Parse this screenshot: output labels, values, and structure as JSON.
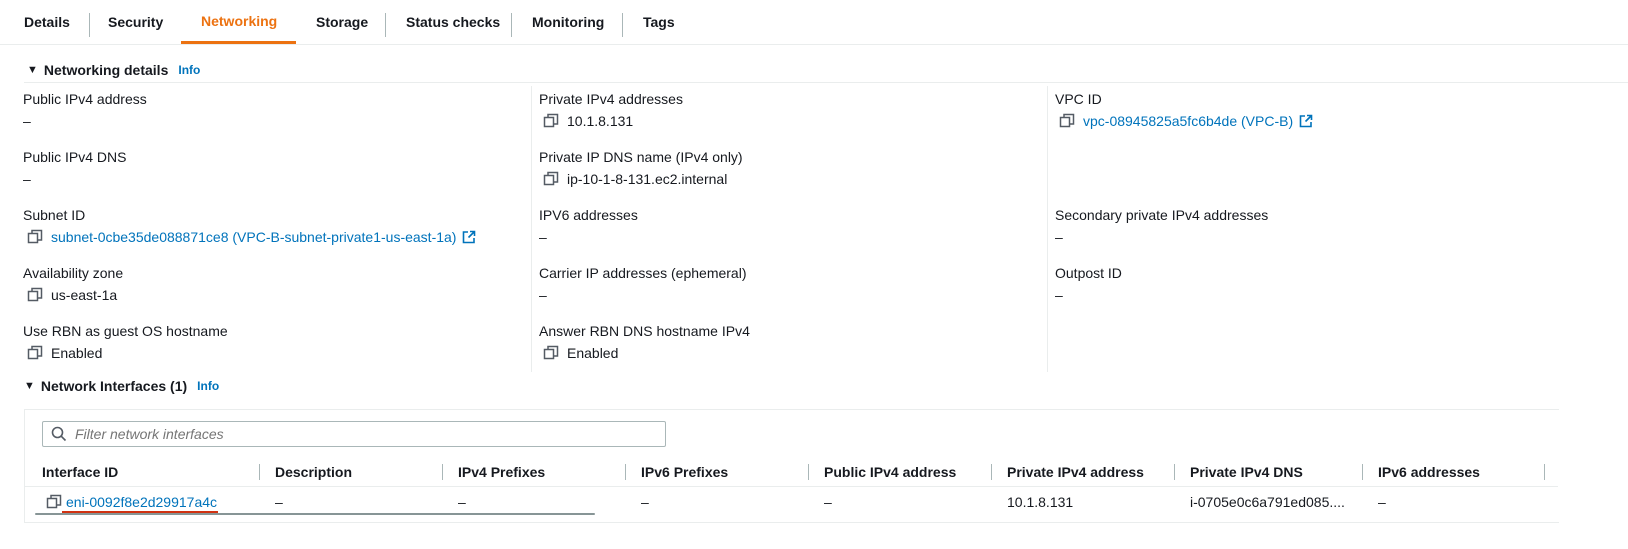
{
  "tabs": [
    "Details",
    "Security",
    "Networking",
    "Storage",
    "Status checks",
    "Monitoring",
    "Tags"
  ],
  "active_tab": "Networking",
  "networking_details": {
    "title": "Networking details",
    "info": "Info",
    "public_ipv4": {
      "label": "Public IPv4 address",
      "value": "–"
    },
    "private_ipv4": {
      "label": "Private IPv4 addresses",
      "value": "10.1.8.131"
    },
    "vpc_id": {
      "label": "VPC ID",
      "value": "vpc-08945825a5fc6b4de (VPC-B)"
    },
    "public_dns": {
      "label": "Public IPv4 DNS",
      "value": "–"
    },
    "private_dns": {
      "label": "Private IP DNS name (IPv4 only)",
      "value": "ip-10-1-8-131.ec2.internal"
    },
    "subnet_id": {
      "label": "Subnet ID",
      "value": "subnet-0cbe35de088871ce8 (VPC-B-subnet-private1-us-east-1a)"
    },
    "ipv6": {
      "label": "IPV6 addresses",
      "value": "–"
    },
    "secondary_private": {
      "label": "Secondary private IPv4 addresses",
      "value": "–"
    },
    "az": {
      "label": "Availability zone",
      "value": "us-east-1a"
    },
    "carrier_ip": {
      "label": "Carrier IP addresses (ephemeral)",
      "value": "–"
    },
    "outpost": {
      "label": "Outpost ID",
      "value": "–"
    },
    "rbn_hostname": {
      "label": "Use RBN as guest OS hostname",
      "value": "Enabled"
    },
    "rbn_dns": {
      "label": "Answer RBN DNS hostname IPv4",
      "value": "Enabled"
    }
  },
  "network_interfaces": {
    "title": "Network Interfaces (1)",
    "info": "Info",
    "filter_placeholder": "Filter network interfaces",
    "columns": [
      "Interface ID",
      "Description",
      "IPv4 Prefixes",
      "IPv6 Prefixes",
      "Public IPv4 address",
      "Private IPv4 address",
      "Private IPv4 DNS",
      "IPv6 addresses"
    ],
    "rows": [
      [
        "eni-0092f8e2d29917a4c",
        "–",
        "–",
        "–",
        "–",
        "10.1.8.131",
        "i-0705e0c6a791ed085....",
        "–"
      ]
    ]
  },
  "colors": {
    "accent": "#ec7211",
    "link": "#0073bb",
    "highlight": "#d13212"
  }
}
